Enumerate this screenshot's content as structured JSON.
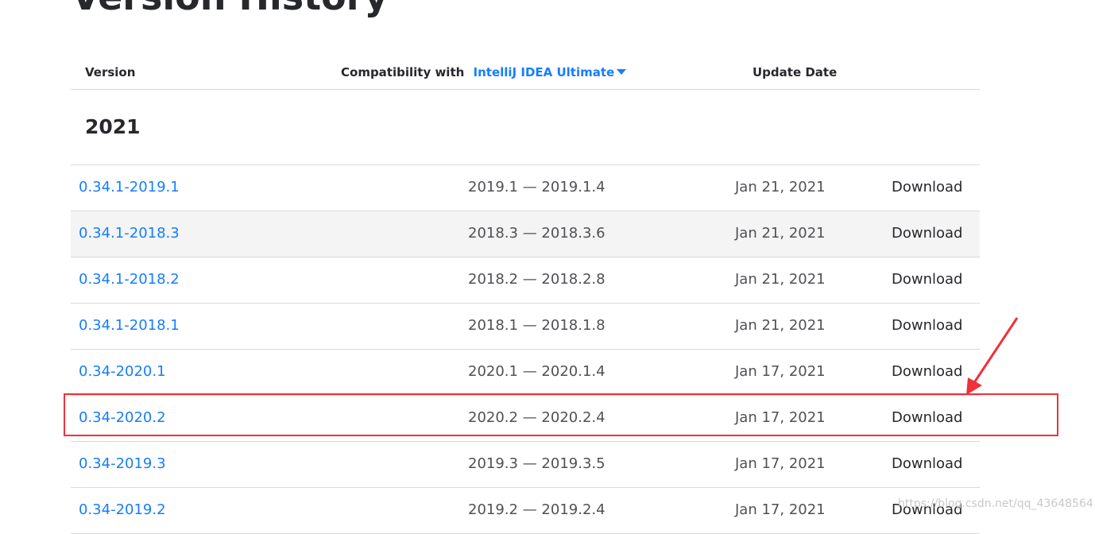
{
  "page": {
    "title": "Version History"
  },
  "table": {
    "headers": {
      "version": "Version",
      "compatibility": "Compatibility with",
      "product": "IntelliJ IDEA Ultimate",
      "update_date": "Update Date"
    },
    "year": "2021",
    "rows": [
      {
        "version": "0.34.1-2019.1",
        "compatibility": "2019.1 — 2019.1.4",
        "date": "Jan 21, 2021",
        "download": "Download"
      },
      {
        "version": "0.34.1-2018.3",
        "compatibility": "2018.3 — 2018.3.6",
        "date": "Jan 21, 2021",
        "download": "Download"
      },
      {
        "version": "0.34.1-2018.2",
        "compatibility": "2018.2 — 2018.2.8",
        "date": "Jan 21, 2021",
        "download": "Download"
      },
      {
        "version": "0.34.1-2018.1",
        "compatibility": "2018.1 — 2018.1.8",
        "date": "Jan 21, 2021",
        "download": "Download"
      },
      {
        "version": "0.34-2020.1",
        "compatibility": "2020.1 — 2020.1.4",
        "date": "Jan 17, 2021",
        "download": "Download"
      },
      {
        "version": "0.34-2020.2",
        "compatibility": "2020.2 — 2020.2.4",
        "date": "Jan 17, 2021",
        "download": "Download"
      },
      {
        "version": "0.34-2019.3",
        "compatibility": "2019.3 — 2019.3.5",
        "date": "Jan 17, 2021",
        "download": "Download"
      },
      {
        "version": "0.34-2019.2",
        "compatibility": "2019.2 — 2019.2.4",
        "date": "Jan 17, 2021",
        "download": "Download"
      }
    ]
  },
  "watermark": "https://blog.csdn.net/qq_43648564",
  "colors": {
    "link": "#167dff",
    "highlight": "#f0303a",
    "alt_row": "#f4f4f4"
  }
}
